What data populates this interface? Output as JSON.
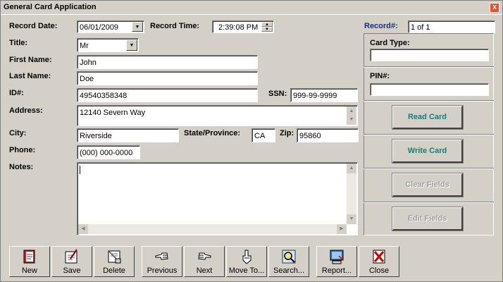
{
  "window": {
    "title": "General Card Application",
    "close_glyph": "x"
  },
  "form": {
    "record_date_label": "Record Date:",
    "record_date_value": "06/01/2009",
    "record_time_label": "Record Time:",
    "record_time_value": "2:39:08 PM",
    "record_num_label": "Record#:",
    "record_num_value": "1 of 1",
    "title_label": "Title:",
    "title_value": "Mr",
    "first_name_label": "First Name:",
    "first_name_value": "John",
    "last_name_label": "Last Name:",
    "last_name_value": "Doe",
    "id_label": "ID#:",
    "id_value": "49540358348",
    "ssn_label": "SSN:",
    "ssn_value": "999-99-9999",
    "address_label": "Address:",
    "address_value": "12140 Severn Way",
    "city_label": "City:",
    "city_value": "Riverside",
    "state_label": "State/Province:",
    "state_value": "CA",
    "zip_label": "Zip:",
    "zip_value": "95860",
    "phone_label": "Phone:",
    "phone_value": "(000) 000-0000",
    "notes_label": "Notes:",
    "notes_value": ""
  },
  "card_panel": {
    "card_type_label": "Card Type:",
    "card_type_value": "",
    "pin_label": "PIN#:",
    "pin_value": "",
    "read_card": "Read Card",
    "write_card": "Write Card",
    "clear_fields": "Clear Fields",
    "edit_fields": "Edit Fields"
  },
  "toolbar": {
    "new": "New",
    "save": "Save",
    "delete": "Delete",
    "previous": "Previous",
    "next": "Next",
    "move_to": "Move To...",
    "search": "Search...",
    "report": "Report...",
    "close": "Close"
  },
  "colors": {
    "accent": "#1e7a78",
    "record_label": "#1a2a8a",
    "close_red": "#e8502c"
  }
}
